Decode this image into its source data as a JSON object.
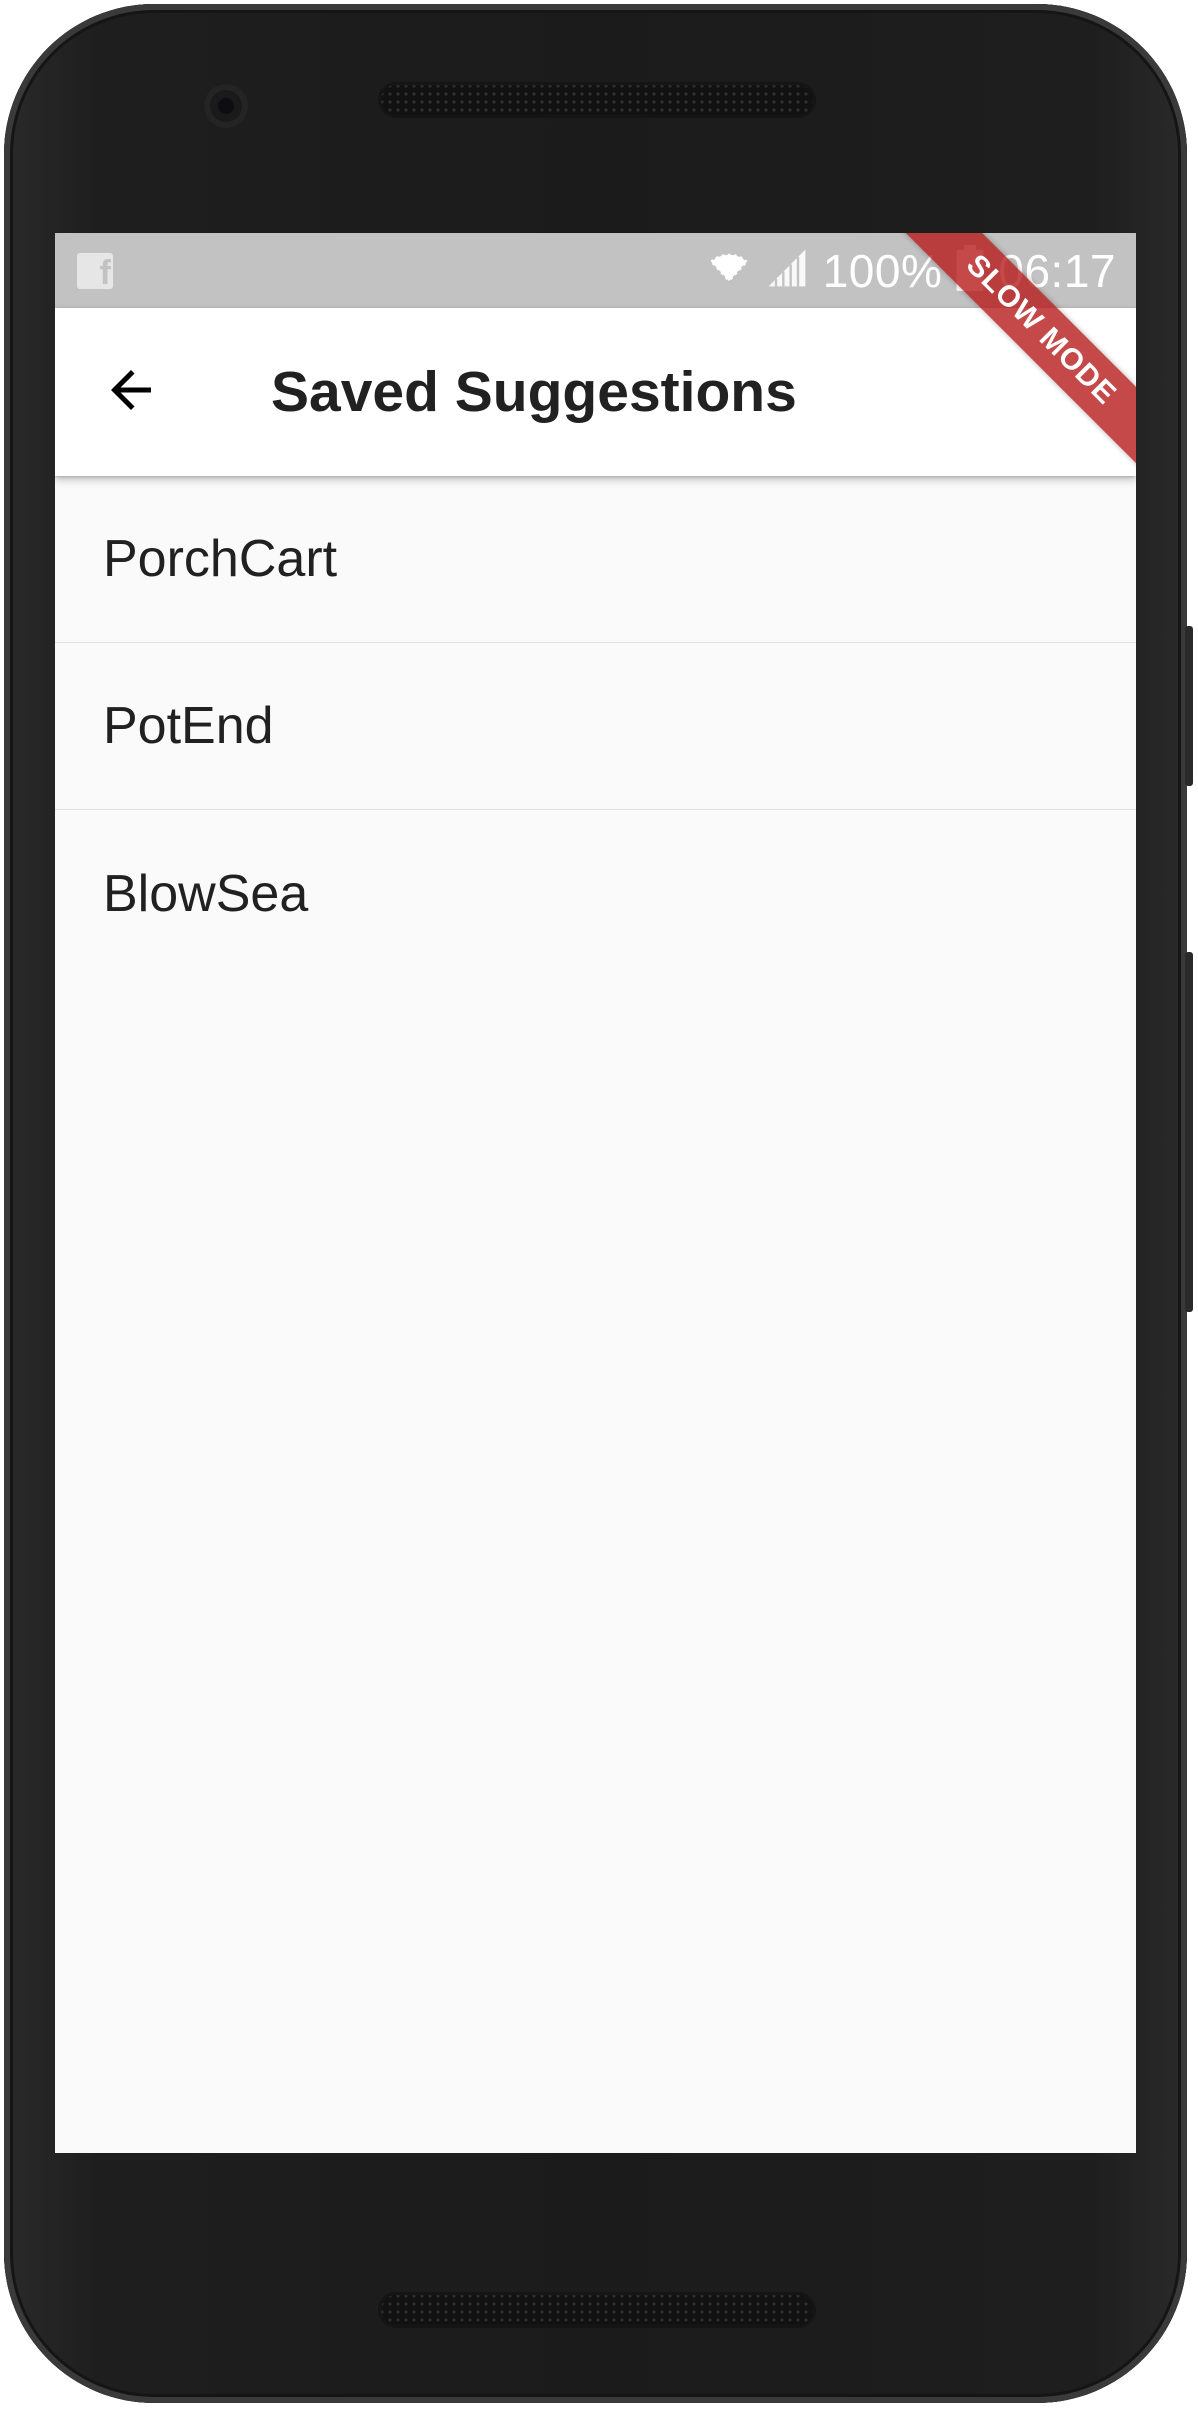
{
  "status_bar": {
    "notification_icon": "facebook-icon",
    "battery_text": "100%",
    "time": "06:17",
    "wifi_icon": "wifi-icon",
    "signal_icon": "signal-icon",
    "battery_icon": "battery-icon"
  },
  "debug_banner": {
    "label": "SLOW MODE",
    "color": "#b71c1c"
  },
  "app_bar": {
    "back_icon": "arrow-back-icon",
    "title": "Saved Suggestions"
  },
  "list": {
    "items": [
      {
        "label": "PorchCart"
      },
      {
        "label": "PotEnd"
      },
      {
        "label": "BlowSea"
      }
    ]
  },
  "colors": {
    "status_bar_bg": "#c2c2c2",
    "app_bar_bg": "#ffffff",
    "screen_bg": "#fafafa",
    "text": "#212121",
    "device_body": "#1e1e1e"
  }
}
